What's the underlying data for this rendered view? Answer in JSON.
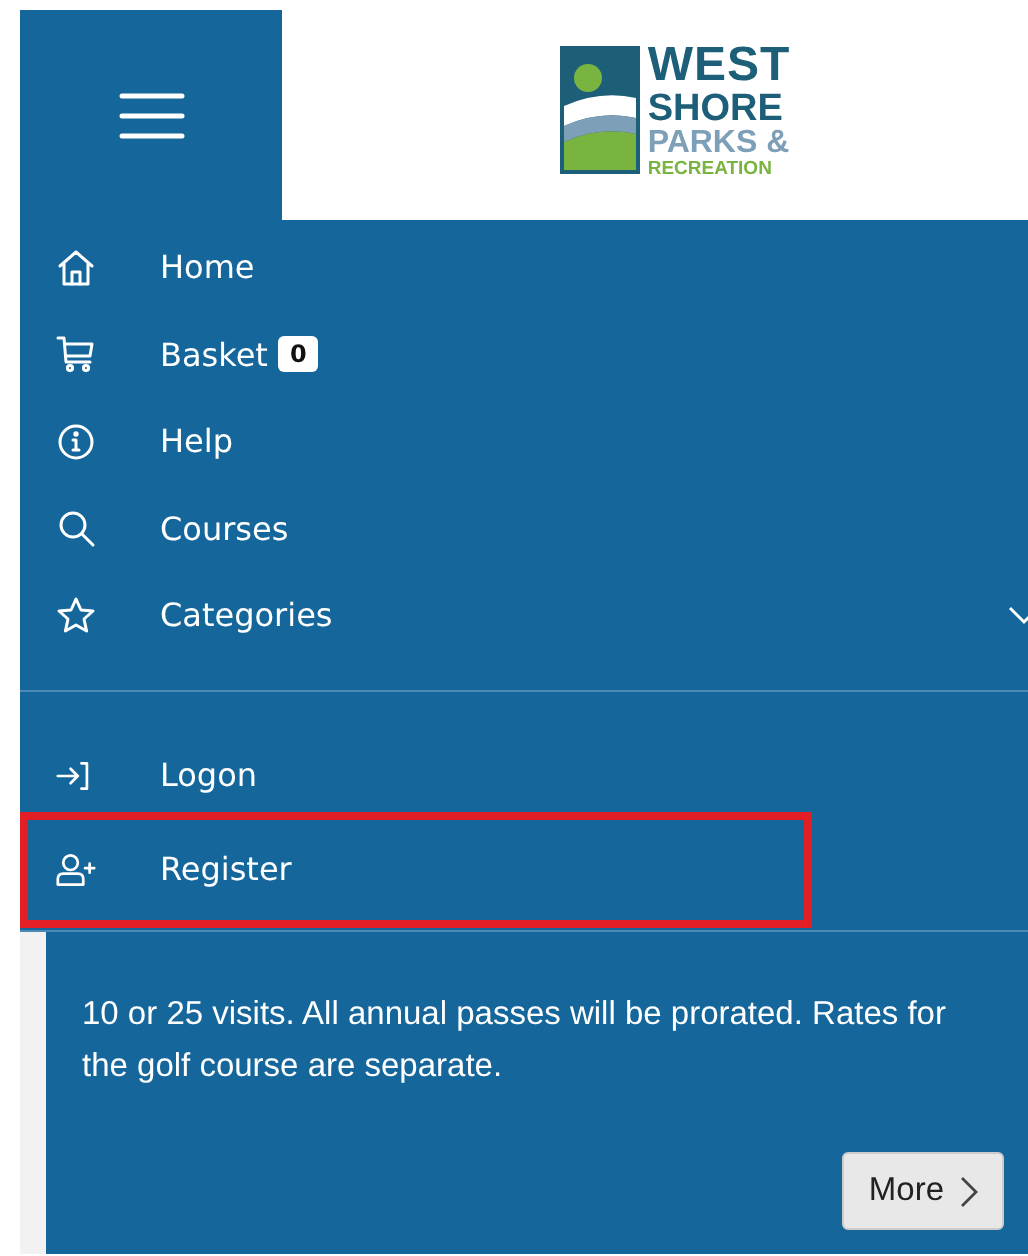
{
  "header": {
    "logo_lines": [
      {
        "text": "WEST",
        "color": "#1d5f78"
      },
      {
        "text": "SHORE",
        "color": "#1d5f78"
      },
      {
        "text": "PARKS &",
        "color": "#7e9fb8"
      },
      {
        "text": "RECREATION",
        "color": "#7ab440"
      }
    ]
  },
  "menu": {
    "items": [
      {
        "kind": "home",
        "label": "Home"
      },
      {
        "kind": "cart",
        "label": "Basket",
        "badge": "0"
      },
      {
        "kind": "info",
        "label": "Help"
      },
      {
        "kind": "search",
        "label": "Courses"
      },
      {
        "kind": "star",
        "label": "Categories",
        "expandable": true
      }
    ],
    "account_items": [
      {
        "kind": "logon",
        "label": "Logon",
        "highlighted": false
      },
      {
        "kind": "register",
        "label": "Register",
        "highlighted": true
      }
    ]
  },
  "card": {
    "text": "10 or 25 visits. All annual passes will be prorated. Rates for the golf course are separate.",
    "button": "More"
  }
}
